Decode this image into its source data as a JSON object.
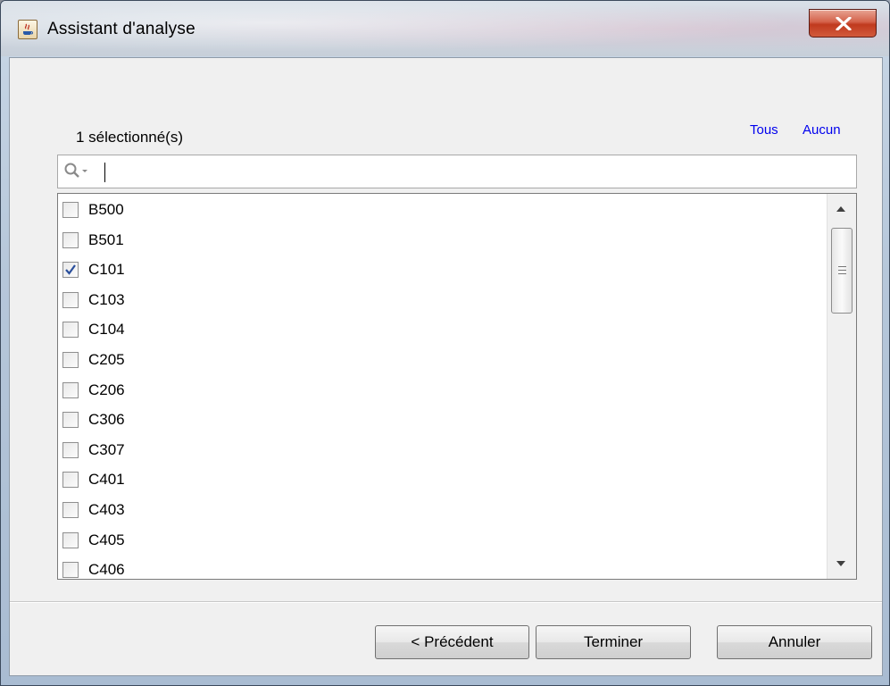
{
  "window": {
    "title": "Assistant d'analyse"
  },
  "selection": {
    "count_label": "1 sélectionné(s)",
    "all_link": "Tous",
    "none_link": "Aucun"
  },
  "search": {
    "value": "",
    "icon": "search-icon"
  },
  "list": {
    "items": [
      {
        "label": "B500",
        "checked": false
      },
      {
        "label": "B501",
        "checked": false
      },
      {
        "label": "C101",
        "checked": true
      },
      {
        "label": "C103",
        "checked": false
      },
      {
        "label": "C104",
        "checked": false
      },
      {
        "label": "C205",
        "checked": false
      },
      {
        "label": "C206",
        "checked": false
      },
      {
        "label": "C306",
        "checked": false
      },
      {
        "label": "C307",
        "checked": false
      },
      {
        "label": "C401",
        "checked": false
      },
      {
        "label": "C403",
        "checked": false
      },
      {
        "label": "C405",
        "checked": false
      },
      {
        "label": "C406",
        "checked": false
      }
    ]
  },
  "buttons": {
    "previous": "< Précédent",
    "finish": "Terminer",
    "cancel": "Annuler"
  },
  "colors": {
    "link": "#0000ee",
    "close_button": "#c03a1e"
  }
}
